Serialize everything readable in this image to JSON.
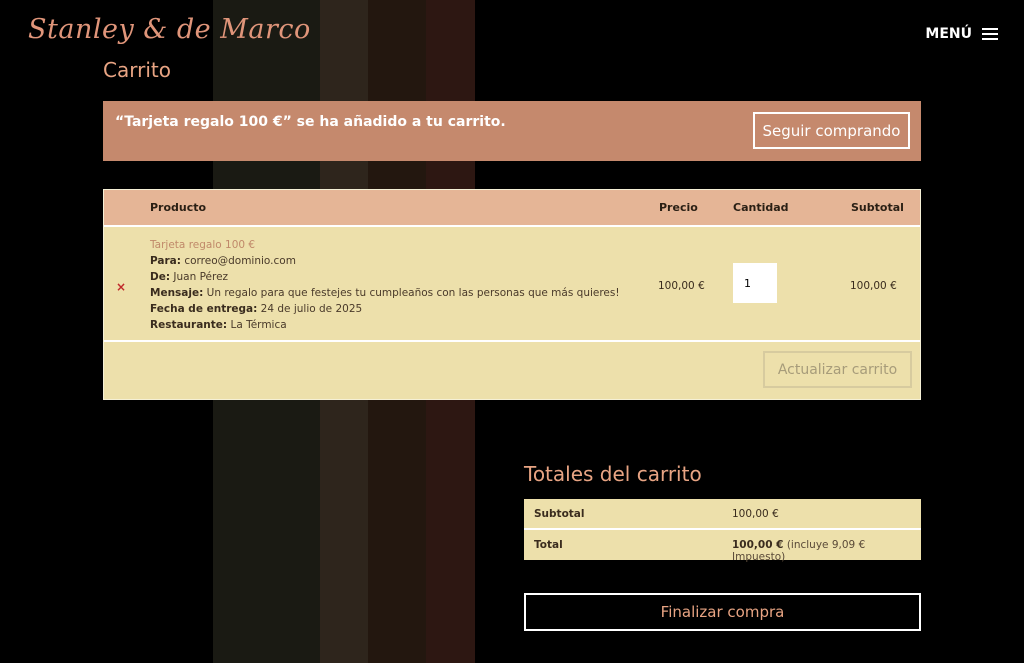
{
  "header": {
    "logo_text": "Stanley & de Marco",
    "menu_label": "MENÚ"
  },
  "page": {
    "title": "Carrito"
  },
  "notice": {
    "message": "“Tarjeta regalo 100 €” se ha añadido a tu carrito.",
    "continue_label": "Seguir comprando"
  },
  "cart": {
    "columns": {
      "product": "Producto",
      "price": "Precio",
      "quantity": "Cantidad",
      "subtotal": "Subtotal"
    },
    "items": [
      {
        "name": "Tarjeta regalo 100 €",
        "to_label": "Para:",
        "to_value": "correo@dominio.com",
        "from_label": "De:",
        "from_value": "Juan Pérez",
        "message_label": "Mensaje:",
        "message_value": "Un regalo para que festejes tu cumpleaños con las personas que más quieres!",
        "delivery_label": "Fecha de entrega:",
        "delivery_value": "24 de julio de 2025",
        "restaurant_label": "Restaurante:",
        "restaurant_value": "La Térmica",
        "price": "100,00 €",
        "quantity": "1",
        "subtotal": "100,00 €",
        "remove_symbol": "×"
      }
    ],
    "update_label": "Actualizar carrito"
  },
  "totals": {
    "title": "Totales del carrito",
    "subtotal_label": "Subtotal",
    "subtotal_value": "100,00 €",
    "total_label": "Total",
    "total_value": "100,00 €",
    "tax_note": "(incluye 9,09 € Impuesto)"
  },
  "checkout": {
    "label": "Finalizar compra"
  },
  "colors": {
    "accent": "#e8a483",
    "notice_bg": "#c5896d",
    "table_bg": "#ede0ab",
    "table_header_bg": "#e5b596",
    "remove": "#c0282a"
  }
}
